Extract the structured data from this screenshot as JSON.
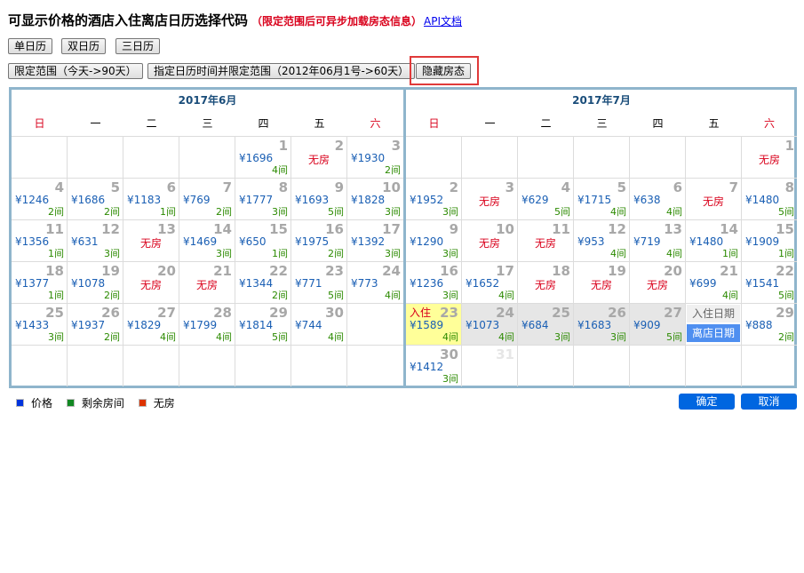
{
  "header": {
    "title": "可显示价格的酒店入住离店日历选择代码",
    "note": "（限定范围后可异步加载房态信息）",
    "api_link": "API文档"
  },
  "buttons": {
    "single": "单日历",
    "double": "双日历",
    "triple": "三日历",
    "limit_range": "限定范围（今天->90天）",
    "specified_range": "指定日历时间并限定范围（2012年06月1号->60天）",
    "hide_status": "隐藏房态"
  },
  "weekdays": [
    "日",
    "一",
    "二",
    "三",
    "四",
    "五",
    "六"
  ],
  "months": [
    {
      "title": "2017年6月",
      "days": [
        {
          "d": "1",
          "p": "¥1696",
          "r": "4间"
        },
        {
          "d": "2",
          "nr": "无房"
        },
        {
          "d": "3",
          "p": "¥1930",
          "r": "2间"
        },
        {
          "d": "4",
          "p": "¥1246",
          "r": "2间"
        },
        {
          "d": "5",
          "p": "¥1686",
          "r": "2间"
        },
        {
          "d": "6",
          "p": "¥1183",
          "r": "1间"
        },
        {
          "d": "7",
          "p": "¥769",
          "r": "2间"
        },
        {
          "d": "8",
          "p": "¥1777",
          "r": "3间"
        },
        {
          "d": "9",
          "p": "¥1693",
          "r": "5间"
        },
        {
          "d": "10",
          "p": "¥1828",
          "r": "3间"
        },
        {
          "d": "11",
          "p": "¥1356",
          "r": "1间"
        },
        {
          "d": "12",
          "p": "¥631",
          "r": "3间"
        },
        {
          "d": "13",
          "nr": "无房"
        },
        {
          "d": "14",
          "p": "¥1469",
          "r": "3间"
        },
        {
          "d": "15",
          "p": "¥650",
          "r": "1间"
        },
        {
          "d": "16",
          "p": "¥1975",
          "r": "2间"
        },
        {
          "d": "17",
          "p": "¥1392",
          "r": "3间"
        },
        {
          "d": "18",
          "p": "¥1377",
          "r": "1间"
        },
        {
          "d": "19",
          "p": "¥1078",
          "r": "2间"
        },
        {
          "d": "20",
          "nr": "无房"
        },
        {
          "d": "21",
          "nr": "无房"
        },
        {
          "d": "22",
          "p": "¥1344",
          "r": "2间"
        },
        {
          "d": "23",
          "p": "¥771",
          "r": "5间"
        },
        {
          "d": "24",
          "p": "¥773",
          "r": "4间"
        },
        {
          "d": "25",
          "p": "¥1433",
          "r": "3间"
        },
        {
          "d": "26",
          "p": "¥1937",
          "r": "2间"
        },
        {
          "d": "27",
          "p": "¥1829",
          "r": "4间"
        },
        {
          "d": "28",
          "p": "¥1799",
          "r": "4间"
        },
        {
          "d": "29",
          "p": "¥1814",
          "r": "5间"
        },
        {
          "d": "30",
          "p": "¥744",
          "r": "4间"
        }
      ]
    },
    {
      "title": "2017年7月",
      "days": [
        {
          "d": "1",
          "nr": "无房"
        },
        {
          "d": "2",
          "p": "¥1952",
          "r": "3间"
        },
        {
          "d": "3",
          "nr": "无房"
        },
        {
          "d": "4",
          "p": "¥629",
          "r": "5间"
        },
        {
          "d": "5",
          "p": "¥1715",
          "r": "4间"
        },
        {
          "d": "6",
          "p": "¥638",
          "r": "4间"
        },
        {
          "d": "7",
          "nr": "无房"
        },
        {
          "d": "8",
          "p": "¥1480",
          "r": "5间"
        },
        {
          "d": "9",
          "p": "¥1290",
          "r": "3间"
        },
        {
          "d": "10",
          "nr": "无房"
        },
        {
          "d": "11",
          "nr": "无房"
        },
        {
          "d": "12",
          "p": "¥953",
          "r": "4间"
        },
        {
          "d": "13",
          "p": "¥719",
          "r": "4间"
        },
        {
          "d": "14",
          "p": "¥1480",
          "r": "1间"
        },
        {
          "d": "15",
          "p": "¥1909",
          "r": "1间"
        },
        {
          "d": "16",
          "p": "¥1236",
          "r": "3间"
        },
        {
          "d": "17",
          "p": "¥1652",
          "r": "4间"
        },
        {
          "d": "18",
          "nr": "无房"
        },
        {
          "d": "19",
          "nr": "无房"
        },
        {
          "d": "20",
          "nr": "无房"
        },
        {
          "d": "21",
          "p": "¥699",
          "r": "4间"
        },
        {
          "d": "22",
          "p": "¥1541",
          "r": "5间"
        },
        {
          "d": "23",
          "p": "¥1589",
          "r": "4间",
          "tag": "入住",
          "state": "in"
        },
        {
          "d": "24",
          "p": "¥1073",
          "r": "4间",
          "state": "range"
        },
        {
          "d": "25",
          "p": "¥684",
          "r": "3间",
          "state": "range"
        },
        {
          "d": "26",
          "p": "¥1683",
          "r": "3间",
          "state": "range"
        },
        {
          "d": "27",
          "p": "¥909",
          "r": "5间",
          "state": "range"
        },
        {
          "d": "28",
          "tip_in": "入住日期",
          "tip_out": "离店日期"
        },
        {
          "d": "29",
          "p": "¥888",
          "r": "2间"
        },
        {
          "d": "30",
          "p": "¥1412",
          "r": "3间"
        },
        {
          "d": "31",
          "faded": true
        }
      ]
    }
  ],
  "legend": {
    "price": "价格",
    "rooms": "剩余房间",
    "none": "无房",
    "colors": {
      "price": "#0033dd",
      "rooms": "#118822",
      "none": "#dd3300"
    }
  },
  "actions": {
    "confirm": "确定",
    "cancel": "取消"
  }
}
